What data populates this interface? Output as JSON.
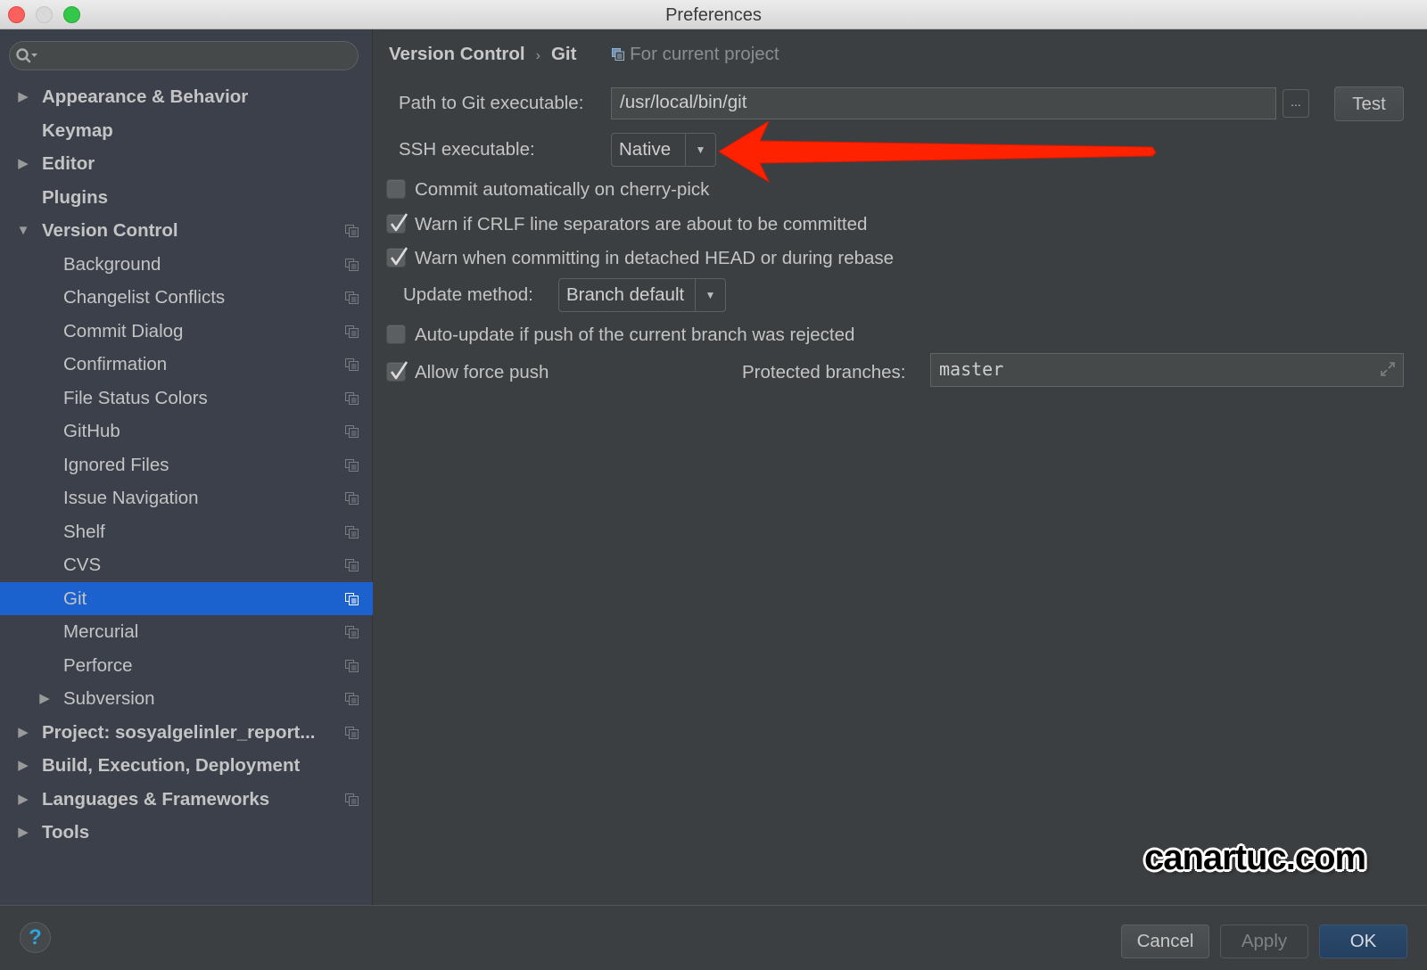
{
  "window": {
    "title": "Preferences"
  },
  "sidebar": {
    "search_placeholder": "",
    "items": [
      {
        "label": "Appearance & Behavior",
        "level": 0,
        "bold": true,
        "expander": "collapsed",
        "project_icon": false
      },
      {
        "label": "Keymap",
        "level": 0,
        "bold": true,
        "expander": "none",
        "project_icon": false
      },
      {
        "label": "Editor",
        "level": 0,
        "bold": true,
        "expander": "collapsed",
        "project_icon": false
      },
      {
        "label": "Plugins",
        "level": 0,
        "bold": true,
        "expander": "none",
        "project_icon": false
      },
      {
        "label": "Version Control",
        "level": 0,
        "bold": true,
        "expander": "expanded",
        "project_icon": true
      },
      {
        "label": "Background",
        "level": 1,
        "bold": false,
        "expander": "none",
        "project_icon": true
      },
      {
        "label": "Changelist Conflicts",
        "level": 1,
        "bold": false,
        "expander": "none",
        "project_icon": true
      },
      {
        "label": "Commit Dialog",
        "level": 1,
        "bold": false,
        "expander": "none",
        "project_icon": true
      },
      {
        "label": "Confirmation",
        "level": 1,
        "bold": false,
        "expander": "none",
        "project_icon": true
      },
      {
        "label": "File Status Colors",
        "level": 1,
        "bold": false,
        "expander": "none",
        "project_icon": true
      },
      {
        "label": "GitHub",
        "level": 1,
        "bold": false,
        "expander": "none",
        "project_icon": true
      },
      {
        "label": "Ignored Files",
        "level": 1,
        "bold": false,
        "expander": "none",
        "project_icon": true
      },
      {
        "label": "Issue Navigation",
        "level": 1,
        "bold": false,
        "expander": "none",
        "project_icon": true
      },
      {
        "label": "Shelf",
        "level": 1,
        "bold": false,
        "expander": "none",
        "project_icon": true
      },
      {
        "label": "CVS",
        "level": 1,
        "bold": false,
        "expander": "none",
        "project_icon": true
      },
      {
        "label": "Git",
        "level": 1,
        "bold": false,
        "expander": "none",
        "project_icon": true,
        "selected": true
      },
      {
        "label": "Mercurial",
        "level": 1,
        "bold": false,
        "expander": "none",
        "project_icon": true
      },
      {
        "label": "Perforce",
        "level": 1,
        "bold": false,
        "expander": "none",
        "project_icon": true
      },
      {
        "label": "Subversion",
        "level": 1,
        "bold": false,
        "expander": "collapsed",
        "project_icon": true
      },
      {
        "label": "Project: sosyalgelinler_report...",
        "level": 0,
        "bold": true,
        "expander": "collapsed",
        "project_icon": true
      },
      {
        "label": "Build, Execution, Deployment",
        "level": 0,
        "bold": true,
        "expander": "collapsed",
        "project_icon": false
      },
      {
        "label": "Languages & Frameworks",
        "level": 0,
        "bold": true,
        "expander": "collapsed",
        "project_icon": true
      },
      {
        "label": "Tools",
        "level": 0,
        "bold": true,
        "expander": "collapsed",
        "project_icon": false
      }
    ]
  },
  "breadcrumb": {
    "parent": "Version Control",
    "separator": "›",
    "current": "Git",
    "scope": "For current project"
  },
  "settings": {
    "git_path_label": "Path to Git executable:",
    "git_path_value": "/usr/local/bin/git",
    "browse_label": "...",
    "test_label": "Test",
    "ssh_label": "SSH executable:",
    "ssh_value": "Native",
    "checkboxes": [
      {
        "label": "Commit automatically on cherry-pick",
        "checked": false
      },
      {
        "label": "Warn if CRLF line separators are about to be committed",
        "checked": true
      },
      {
        "label": "Warn when committing in detached HEAD or during rebase",
        "checked": true
      }
    ],
    "update_method_label": "Update method:",
    "update_method_value": "Branch default",
    "auto_update": {
      "label": "Auto-update if push of the current branch was rejected",
      "checked": false
    },
    "force_push": {
      "label": "Allow force push",
      "checked": true
    },
    "protected_branches_label": "Protected branches:",
    "protected_branches_value": "master"
  },
  "footer": {
    "help_label": "?",
    "cancel_label": "Cancel",
    "apply_label": "Apply",
    "ok_label": "OK"
  },
  "annotations": {
    "arrow_color": "#ff2200",
    "watermark": "canartuc.com"
  },
  "colors": {
    "selection": "#1c62ce",
    "sidebar_bg": "#3b404a",
    "panel_bg": "#3c3f41"
  }
}
